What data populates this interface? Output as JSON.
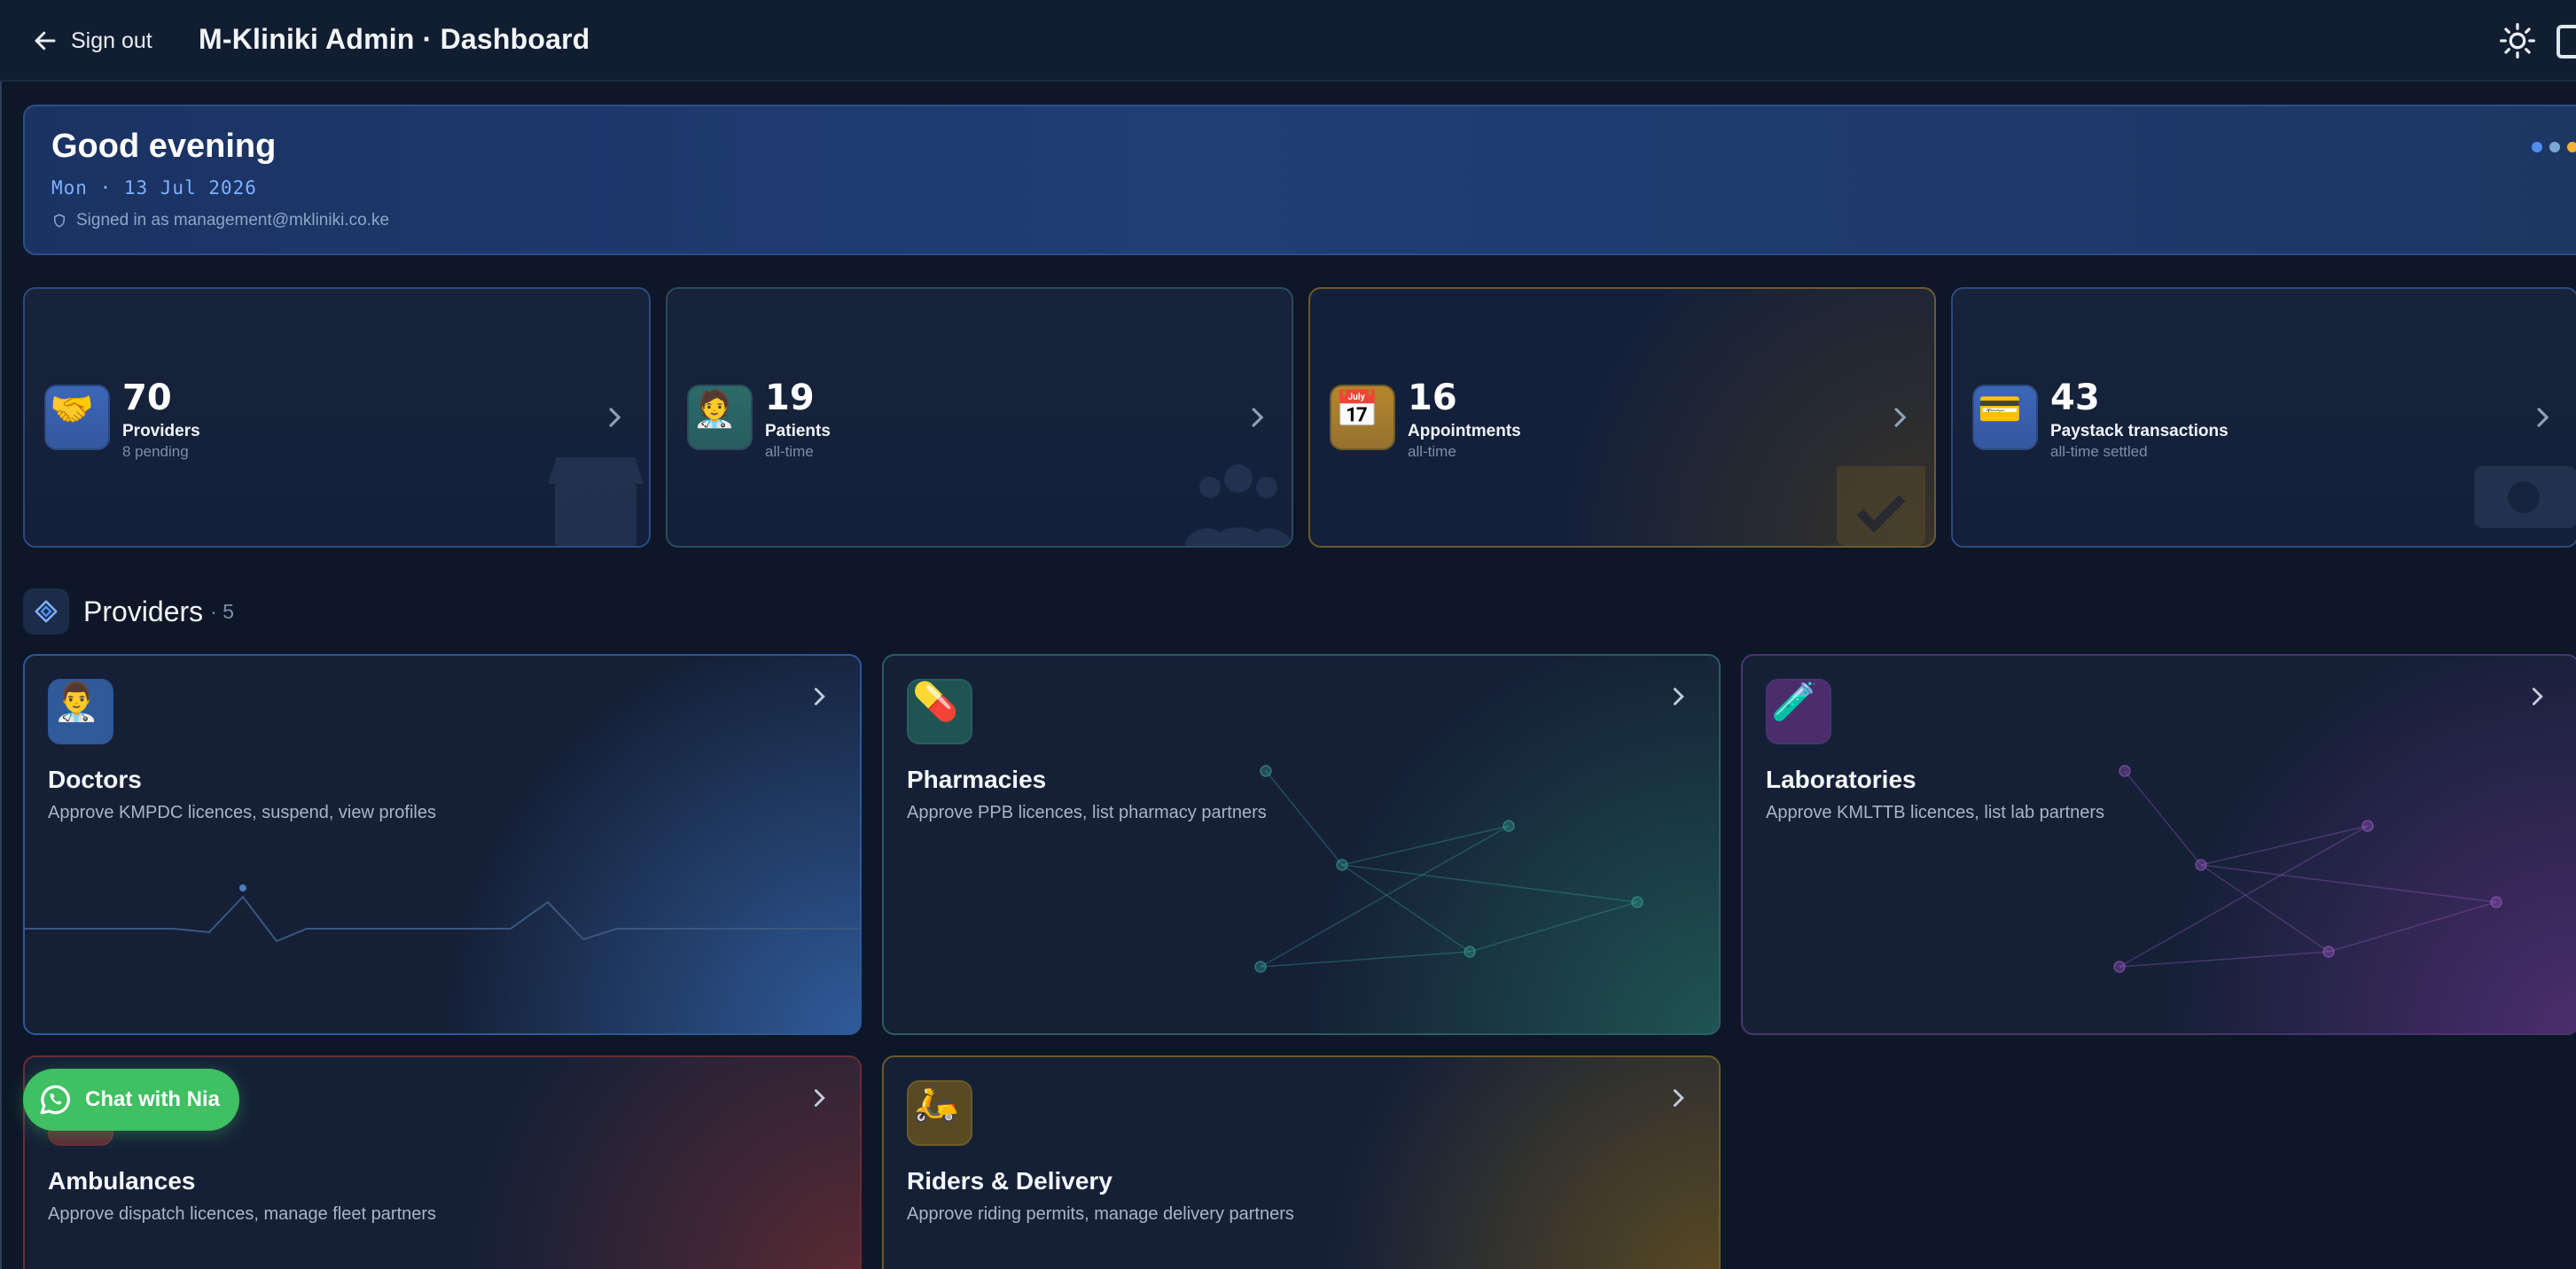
{
  "header": {
    "signout_label": "Sign out",
    "title": "M-Kliniki Admin · Dashboard"
  },
  "greeting": {
    "title": "Good evening",
    "date": "Mon · 13 Jul 2026",
    "signed_in": "Signed in as management@mkliniki.co.ke",
    "dot_colors": [
      "#4f8ef0",
      "#7aa7d8",
      "#f0b23a"
    ]
  },
  "stats": [
    {
      "icon": "handshake-icon",
      "glyph": "🤝",
      "value": "70",
      "label": "Providers",
      "sub": "8 pending",
      "accent": "#3c66b8",
      "border": "#2b4a80"
    },
    {
      "icon": "health-worker-icon",
      "glyph": "🧑‍⚕️",
      "value": "19",
      "label": "Patients",
      "sub": "all-time",
      "accent": "#2c6b69",
      "border": "#2a4b5d"
    },
    {
      "icon": "calendar-icon",
      "glyph": "📅",
      "value": "16",
      "label": "Appointments",
      "sub": "all-time",
      "accent": "#b6862b",
      "border": "#6b5a2c"
    },
    {
      "icon": "credit-card-icon",
      "glyph": "💳",
      "value": "43",
      "label": "Paystack transactions",
      "sub": "all-time settled",
      "accent": "#3c66b8",
      "border": "#2b4a80"
    }
  ],
  "providers": {
    "title": "Providers",
    "count": "· 5",
    "cards": [
      {
        "icon": "doctor-icon",
        "glyph": "👨‍⚕️",
        "title": "Doctors",
        "desc": "Approve KMPDC licences, suspend, view profiles",
        "accent": "#2f5b9a",
        "border": "#2f5896"
      },
      {
        "icon": "pill-icon",
        "glyph": "💊",
        "title": "Pharmacies",
        "desc": "Approve PPB licences, list pharmacy partners",
        "accent": "#1f5452",
        "border": "#2a5d60"
      },
      {
        "icon": "test-tube-icon",
        "glyph": "🧪",
        "title": "Laboratories",
        "desc": "Approve KMLTTB licences, list lab partners",
        "accent": "#4b2d6d",
        "border": "#4a3470"
      },
      {
        "icon": "ambulance-icon",
        "glyph": "🚑",
        "title": "Ambulances",
        "desc": "Approve dispatch licences, manage fleet partners",
        "accent": "#5b2a33",
        "border": "#6a2c38"
      },
      {
        "icon": "scooter-icon",
        "glyph": "🛵",
        "title": "Riders & Delivery",
        "desc": "Approve riding permits, manage delivery partners",
        "accent": "#5a4a23",
        "border": "#6b5a28"
      }
    ]
  },
  "chat": {
    "label": "Chat with Nia"
  }
}
